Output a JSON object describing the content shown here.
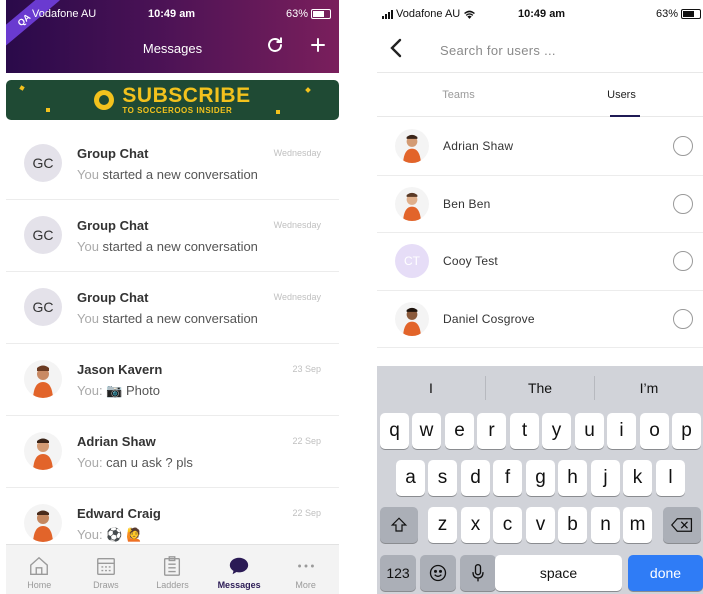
{
  "left": {
    "status": {
      "carrier": "Vodafone AU",
      "time": "10:49 am",
      "battery": "63%"
    },
    "ribbon": "QA",
    "header": {
      "title": "Messages"
    },
    "banner": {
      "title": "SUBSCRIBE",
      "subtitle": "TO SOCCEROOS INSIDER",
      "colors": {
        "bg": "#1f4a34",
        "text": "#f3c21d"
      }
    },
    "chats": [
      {
        "initials": "GC",
        "name": "Group Chat",
        "prefix": "You",
        "message": " started a new conversation",
        "date": "Wednesday"
      },
      {
        "initials": "GC",
        "name": "Group Chat",
        "prefix": "You",
        "message": " started a new conversation",
        "date": "Wednesday"
      },
      {
        "initials": "GC",
        "name": "Group Chat",
        "prefix": "You",
        "message": " started a new conversation",
        "date": "Wednesday"
      },
      {
        "initials": "",
        "name": "Jason Kavern",
        "prefix": "You:",
        "message": " 📷 Photo",
        "date": "23 Sep"
      },
      {
        "initials": "",
        "name": "Adrian Shaw",
        "prefix": "You:",
        "message": " can u ask ? pls",
        "date": "22 Sep"
      },
      {
        "initials": "",
        "name": "Edward Craig",
        "prefix": "You:",
        "message": " ⚽ 🙋",
        "date": "22 Sep"
      }
    ],
    "tabs": [
      {
        "label": "Home",
        "icon": "home-icon"
      },
      {
        "label": "Draws",
        "icon": "calendar-icon"
      },
      {
        "label": "Ladders",
        "icon": "clipboard-icon"
      },
      {
        "label": "Messages",
        "icon": "chat-bubble-icon"
      },
      {
        "label": "More",
        "icon": "more-dots-icon"
      }
    ],
    "colors": {
      "header_start": "#2a0a4a",
      "header_end": "#7a1f5c",
      "active_tab": "#2b1b55"
    }
  },
  "right": {
    "status": {
      "carrier": "Vodafone AU",
      "time": "10:49 am",
      "battery": "63%"
    },
    "search": {
      "placeholder": "Search for users ...",
      "value": ""
    },
    "segments": [
      {
        "label": "Teams"
      },
      {
        "label": "Users"
      }
    ],
    "users": [
      {
        "name": "Adrian Shaw",
        "initials": ""
      },
      {
        "name": "Ben Ben",
        "initials": ""
      },
      {
        "name": "Cooy Test",
        "initials": "CT"
      },
      {
        "name": "Daniel Cosgrove",
        "initials": ""
      }
    ],
    "keyboard": {
      "suggestions": [
        "I",
        "The",
        "I’m"
      ],
      "row1": [
        "q",
        "w",
        "e",
        "r",
        "t",
        "y",
        "u",
        "i",
        "o",
        "p"
      ],
      "row2": [
        "a",
        "s",
        "d",
        "f",
        "g",
        "h",
        "j",
        "k",
        "l"
      ],
      "row3": [
        "z",
        "x",
        "c",
        "v",
        "b",
        "n",
        "m"
      ],
      "numbers_key": "123",
      "space_key": "space",
      "done_key": "done",
      "colors": {
        "done": "#2f7cf6"
      }
    }
  }
}
